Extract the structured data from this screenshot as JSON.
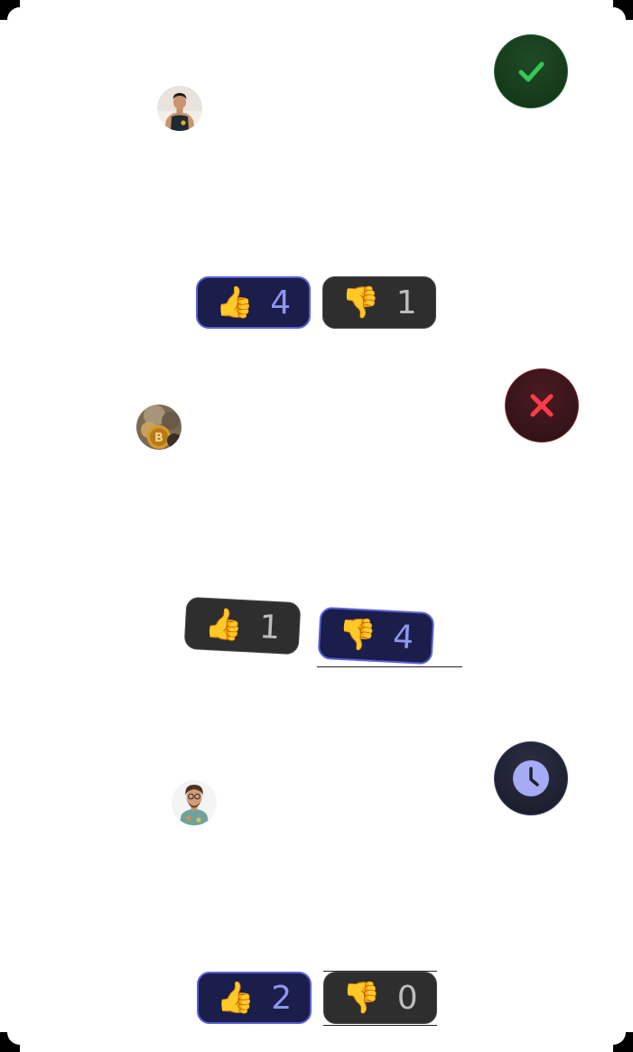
{
  "posts": [
    {
      "status": "approved",
      "status_icon": "check-icon",
      "status_color": "#34c759",
      "avatar": "person-avatar",
      "upvotes": {
        "icon": "👍",
        "count": "4",
        "active": true
      },
      "downvotes": {
        "icon": "👎",
        "count": "1",
        "active": false
      }
    },
    {
      "status": "rejected",
      "status_icon": "x-icon",
      "status_color": "#ff3b4a",
      "avatar": "bitcoin-avatar",
      "upvotes": {
        "icon": "👍",
        "count": "1",
        "active": false
      },
      "downvotes": {
        "icon": "👎",
        "count": "4",
        "active": true
      }
    },
    {
      "status": "pending",
      "status_icon": "clock-icon",
      "status_color": "#a5abf5",
      "avatar": "person-avatar",
      "upvotes": {
        "icon": "👍",
        "count": "2",
        "active": true
      },
      "downvotes": {
        "icon": "👎",
        "count": "0",
        "active": false
      }
    }
  ]
}
